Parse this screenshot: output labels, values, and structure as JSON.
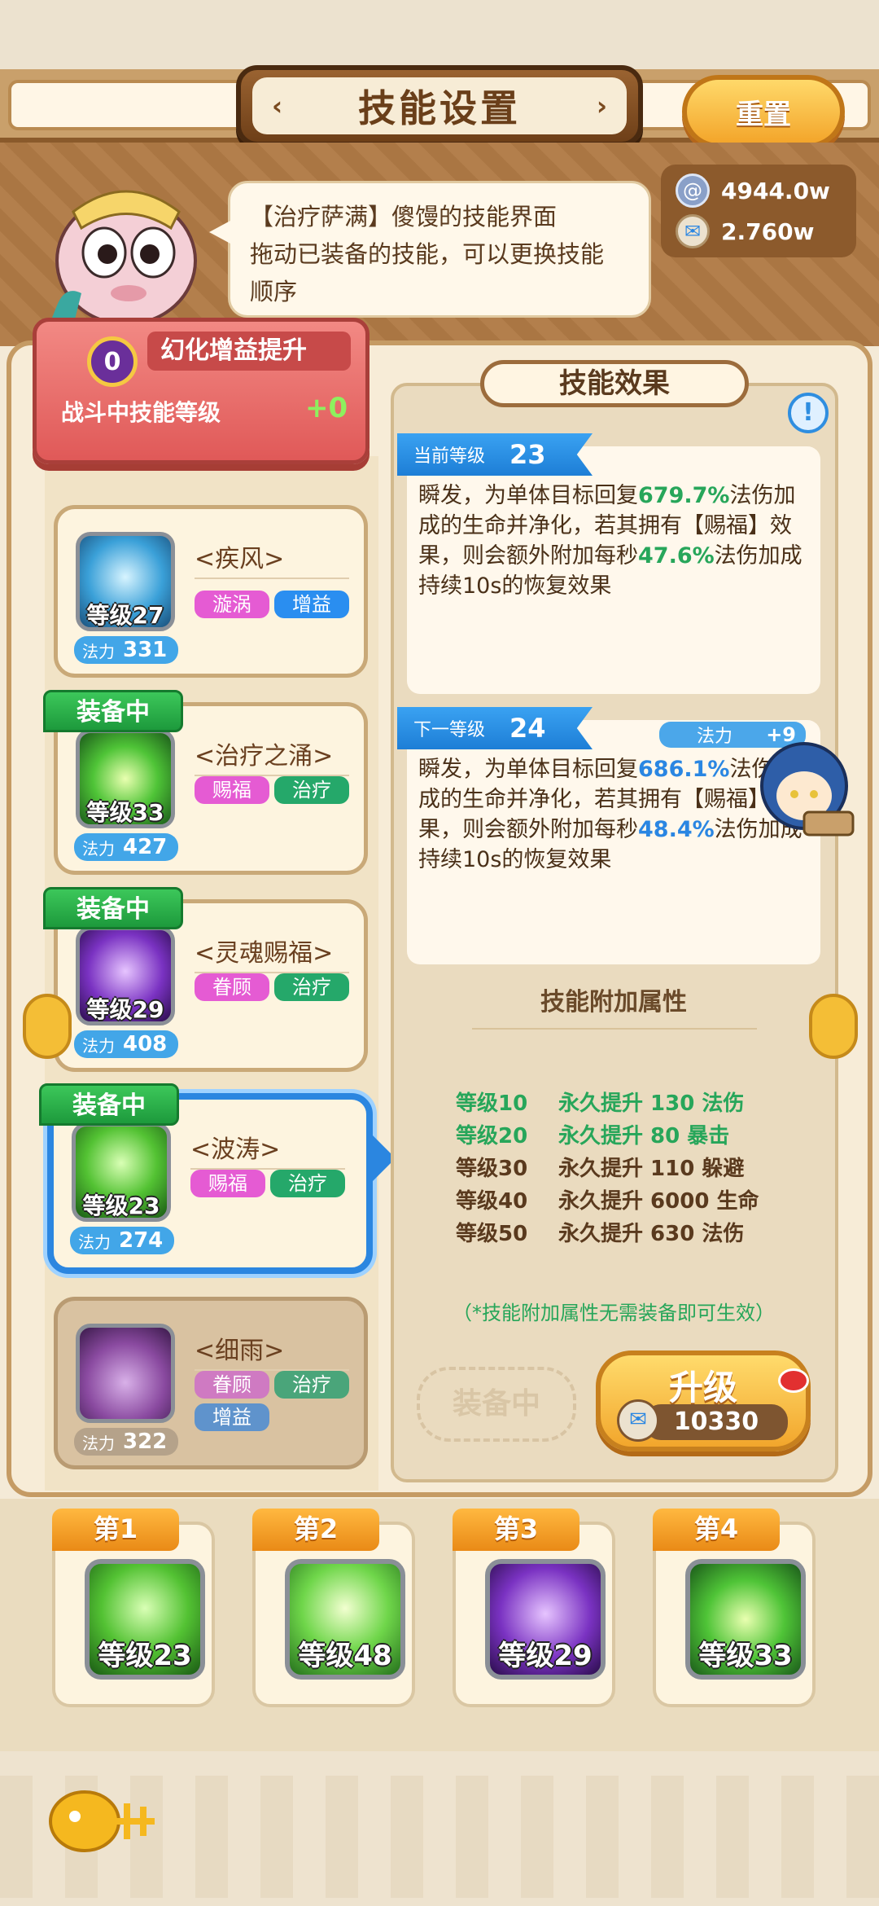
{
  "header": {
    "title": "技能设置",
    "reset_label": "重置"
  },
  "dialog": {
    "line1": "【治疗萨满】傻馒的技能界面",
    "line2": "拖动已装备的技能，可以更换技能",
    "line3": "顺序"
  },
  "currency": [
    {
      "icon": "spiral-coin-icon",
      "value": "4944.0w"
    },
    {
      "icon": "scroll-icon",
      "value": "2.760w"
    }
  ],
  "buff": {
    "level": "0",
    "title": "幻化增益提升",
    "subtitle": "战斗中技能等级",
    "value": "+0"
  },
  "skills": [
    {
      "name": "<疾风>",
      "level": "等级27",
      "mana_label": "法力",
      "mana": "331",
      "equipped": false,
      "equip_label": "",
      "tags": [
        "漩涡",
        "增益"
      ]
    },
    {
      "name": "<治疗之涌>",
      "level": "等级33",
      "mana_label": "法力",
      "mana": "427",
      "equipped": true,
      "equip_label": "装备中",
      "tags": [
        "赐福",
        "治疗"
      ]
    },
    {
      "name": "<灵魂赐福>",
      "level": "等级29",
      "mana_label": "法力",
      "mana": "408",
      "equipped": true,
      "equip_label": "装备中",
      "tags": [
        "眷顾",
        "治疗"
      ]
    },
    {
      "name": "<波涛>",
      "level": "等级23",
      "mana_label": "法力",
      "mana": "274",
      "equipped": true,
      "equip_label": "装备中",
      "tags": [
        "赐福",
        "治疗"
      ]
    },
    {
      "name": "<细雨>",
      "level": "",
      "mana_label": "法力",
      "mana": "322",
      "equipped": false,
      "equip_label": "",
      "tags": [
        "眷顾",
        "治疗",
        "增益"
      ]
    }
  ],
  "effect": {
    "header": "技能效果",
    "info": "!",
    "current": {
      "label": "当前等级",
      "level": "23",
      "t1": "瞬发，为单体目标回复",
      "v1": "679.7%",
      "t2": "法伤加成的生命并净化，若其拥有【赐福】效果，则会额外附加每秒",
      "v2": "47.6%",
      "t3": "法伤加成持续10s的恢复效果"
    },
    "next": {
      "label": "下一等级",
      "level": "24",
      "mana_label": "法力",
      "mana_delta": "+9",
      "t1": "瞬发，为单体目标回复",
      "v1": "686.1%",
      "t2": "法伤加成的生命并净化，若其拥有【赐福】效果，则会额外附加每秒",
      "v2": "48.4%",
      "t3": "法伤加成持续10s的恢复效果"
    }
  },
  "attributes": {
    "title": "技能附加属性",
    "rows": [
      {
        "level": "等级10",
        "effect": "永久提升 130 法伤",
        "unlocked": true
      },
      {
        "level": "等级20",
        "effect": "永久提升 80 暴击",
        "unlocked": true
      },
      {
        "level": "等级30",
        "effect": "永久提升 110 躲避",
        "unlocked": false
      },
      {
        "level": "等级40",
        "effect": "永久提升 6000 生命",
        "unlocked": false
      },
      {
        "level": "等级50",
        "effect": "永久提升 630 法伤",
        "unlocked": false
      }
    ],
    "note": "（*技能附加属性无需装备即可生效）"
  },
  "actions": {
    "equipped_label": "装备中",
    "upgrade_label": "升级",
    "upgrade_cost": "10330"
  },
  "slots": [
    {
      "label": "第1",
      "level": "等级23"
    },
    {
      "label": "第2",
      "level": "等级48"
    },
    {
      "label": "第3",
      "level": "等级29"
    },
    {
      "label": "第4",
      "level": "等级33"
    }
  ],
  "colors": {
    "accent_green": "#27a65a",
    "accent_blue": "#2a86e2",
    "selected_border": "#2b86e0"
  }
}
